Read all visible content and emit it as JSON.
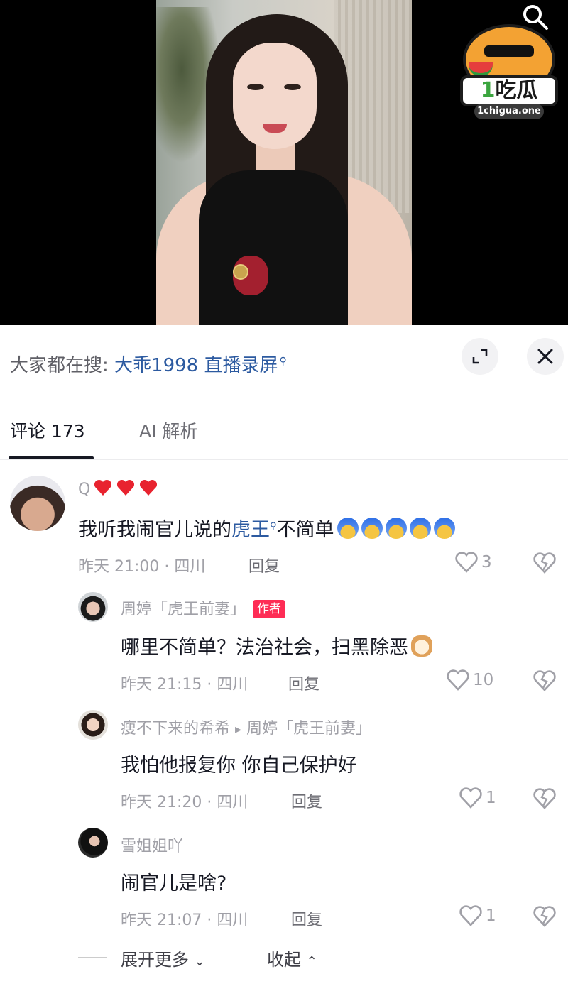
{
  "logo": {
    "text_main": "吃瓜",
    "text_digit": "1",
    "url": "1chigua.one"
  },
  "hot_search": {
    "prefix": "大家都在搜:",
    "term": "大乖1998 直播录屏"
  },
  "tabs": [
    {
      "label": "评论 173",
      "active": true
    },
    {
      "label": "AI 解析",
      "active": false
    }
  ],
  "comments": [
    {
      "username": "Q",
      "text_before": "我听我闹官儿说的",
      "link": "虎王",
      "text_after": "不简单",
      "time_location": "昨天 21:00 · 四川",
      "reply_label": "回复",
      "likes": "3"
    },
    {
      "username": "周婷「虎王前妻」",
      "badge": "作者",
      "text": "哪里不简单？法治社会，扫黑除恶",
      "time_location": "昨天 21:15 · 四川",
      "reply_label": "回复",
      "likes": "10"
    },
    {
      "username": "瘦不下来的希希",
      "reply_to": "周婷「虎王前妻」",
      "text": "我怕他报复你 你自己保护好",
      "time_location": "昨天 21:20 · 四川",
      "reply_label": "回复",
      "likes": "1"
    },
    {
      "username": "雪姐姐吖",
      "text": "闹官儿是啥?",
      "time_location": "昨天 21:07 · 四川",
      "reply_label": "回复",
      "likes": "1"
    }
  ],
  "footer": {
    "expand_more": "展开更多",
    "collapse": "收起"
  },
  "colors": {
    "link_blue": "#2c5aa0",
    "author_badge": "#fe2c55",
    "heart_red": "#e8232f"
  },
  "icons": [
    "search-icon",
    "expand-icon",
    "close-icon",
    "heart-outline-icon",
    "broken-heart-icon",
    "chevron-down-icon",
    "chevron-up-icon"
  ]
}
